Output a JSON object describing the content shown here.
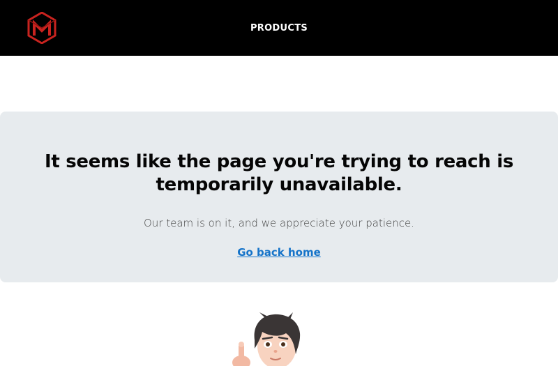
{
  "header": {
    "logo_icon": "m-cube-logo",
    "nav_label": "PRODUCTS",
    "brand_color": "#d42b27"
  },
  "error_card": {
    "headline": "It seems like the page you're trying to reach is temporarily unavailable.",
    "subtext": "Our team is on it, and we appreciate your patience.",
    "home_link": "Go back home",
    "link_color": "#1473c9",
    "background_color": "#e7ebee"
  },
  "illustration": {
    "icon": "cartoon-boy-pointing-illustration"
  }
}
